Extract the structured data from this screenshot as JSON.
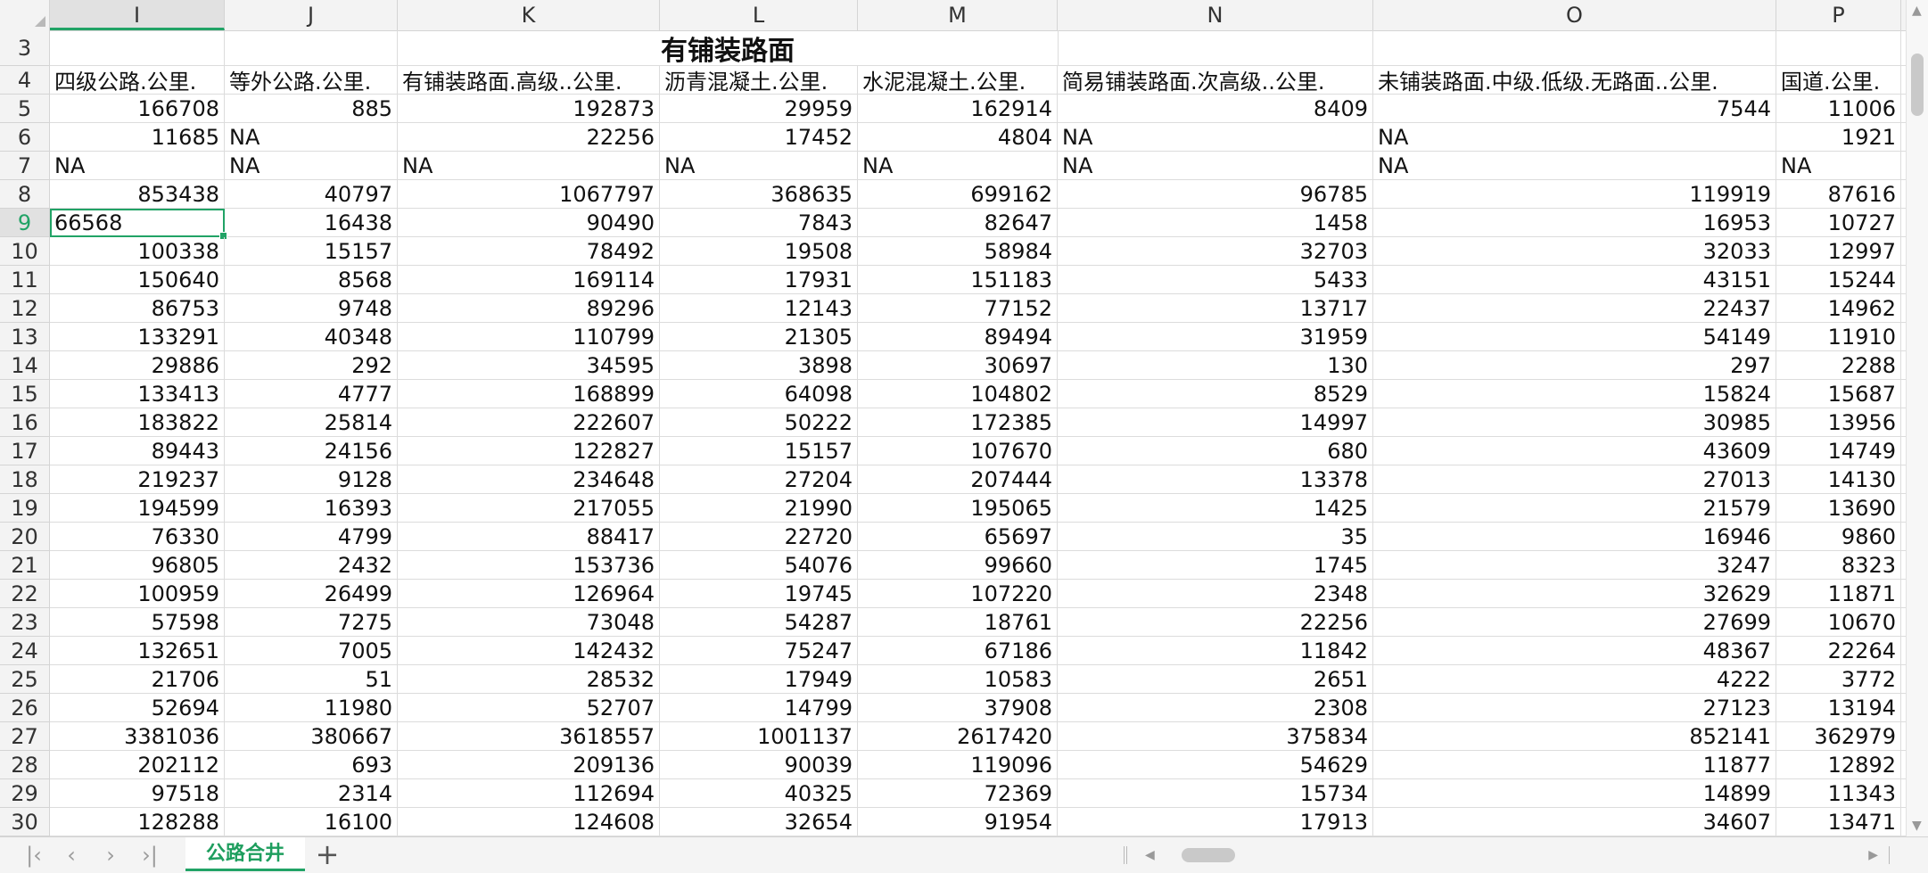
{
  "columns": [
    "I",
    "J",
    "K",
    "L",
    "M",
    "N",
    "O",
    "P"
  ],
  "active_column": "I",
  "active_row": "9",
  "title": "有铺装路面",
  "headers": [
    "四级公路.公里.",
    "等外公路.公里.",
    "有铺装路面.高级..公里.",
    "沥青混凝土.公里.",
    "水泥混凝土.公里.",
    "简易铺装路面.次高级..公里.",
    "未铺装路面.中级.低级.无路面..公里.",
    "国道.公里."
  ],
  "rows": [
    {
      "n": "5",
      "v": [
        "166708",
        "885",
        "192873",
        "29959",
        "162914",
        "8409",
        "7544",
        "11006"
      ]
    },
    {
      "n": "6",
      "v": [
        "11685",
        "NA",
        "22256",
        "17452",
        "4804",
        "NA",
        "NA",
        "1921"
      ]
    },
    {
      "n": "7",
      "v": [
        "NA",
        "NA",
        "NA",
        "NA",
        "NA",
        "NA",
        "NA",
        "NA"
      ]
    },
    {
      "n": "8",
      "v": [
        "853438",
        "40797",
        "1067797",
        "368635",
        "699162",
        "96785",
        "119919",
        "87616"
      ]
    },
    {
      "n": "9",
      "v": [
        "66568",
        "16438",
        "90490",
        "7843",
        "82647",
        "1458",
        "16953",
        "10727"
      ]
    },
    {
      "n": "10",
      "v": [
        "100338",
        "15157",
        "78492",
        "19508",
        "58984",
        "32703",
        "32033",
        "12997"
      ]
    },
    {
      "n": "11",
      "v": [
        "150640",
        "8568",
        "169114",
        "17931",
        "151183",
        "5433",
        "43151",
        "15244"
      ]
    },
    {
      "n": "12",
      "v": [
        "86753",
        "9748",
        "89296",
        "12143",
        "77152",
        "13717",
        "22437",
        "14962"
      ]
    },
    {
      "n": "13",
      "v": [
        "133291",
        "40348",
        "110799",
        "21305",
        "89494",
        "31959",
        "54149",
        "11910"
      ]
    },
    {
      "n": "14",
      "v": [
        "29886",
        "292",
        "34595",
        "3898",
        "30697",
        "130",
        "297",
        "2288"
      ]
    },
    {
      "n": "15",
      "v": [
        "133413",
        "4777",
        "168899",
        "64098",
        "104802",
        "8529",
        "15824",
        "15687"
      ]
    },
    {
      "n": "16",
      "v": [
        "183822",
        "25814",
        "222607",
        "50222",
        "172385",
        "14997",
        "30985",
        "13956"
      ]
    },
    {
      "n": "17",
      "v": [
        "89443",
        "24156",
        "122827",
        "15157",
        "107670",
        "680",
        "43609",
        "14749"
      ]
    },
    {
      "n": "18",
      "v": [
        "219237",
        "9128",
        "234648",
        "27204",
        "207444",
        "13378",
        "27013",
        "14130"
      ]
    },
    {
      "n": "19",
      "v": [
        "194599",
        "16393",
        "217055",
        "21990",
        "195065",
        "1425",
        "21579",
        "13690"
      ]
    },
    {
      "n": "20",
      "v": [
        "76330",
        "4799",
        "88417",
        "22720",
        "65697",
        "35",
        "16946",
        "9860"
      ]
    },
    {
      "n": "21",
      "v": [
        "96805",
        "2432",
        "153736",
        "54076",
        "99660",
        "1745",
        "3247",
        "8323"
      ]
    },
    {
      "n": "22",
      "v": [
        "100959",
        "26499",
        "126964",
        "19745",
        "107220",
        "2348",
        "32629",
        "11871"
      ]
    },
    {
      "n": "23",
      "v": [
        "57598",
        "7275",
        "73048",
        "54287",
        "18761",
        "22256",
        "27699",
        "10670"
      ]
    },
    {
      "n": "24",
      "v": [
        "132651",
        "7005",
        "142432",
        "75247",
        "67186",
        "11842",
        "48367",
        "22264"
      ]
    },
    {
      "n": "25",
      "v": [
        "21706",
        "51",
        "28532",
        "17949",
        "10583",
        "2651",
        "4222",
        "3772"
      ]
    },
    {
      "n": "26",
      "v": [
        "52694",
        "11980",
        "52707",
        "14799",
        "37908",
        "2308",
        "27123",
        "13194"
      ]
    },
    {
      "n": "27",
      "v": [
        "3381036",
        "380667",
        "3618557",
        "1001137",
        "2617420",
        "375834",
        "852141",
        "362979"
      ]
    },
    {
      "n": "28",
      "v": [
        "202112",
        "693",
        "209136",
        "90039",
        "119096",
        "54629",
        "11877",
        "12892"
      ]
    },
    {
      "n": "29",
      "v": [
        "97518",
        "2314",
        "112694",
        "40325",
        "72369",
        "15734",
        "14899",
        "11343"
      ]
    },
    {
      "n": "30",
      "v": [
        "128288",
        "16100",
        "124608",
        "32654",
        "91954",
        "17913",
        "34607",
        "13471"
      ]
    }
  ],
  "sheet_tab": "公路合井",
  "nav": {
    "first": "|‹",
    "prev": "‹",
    "next": "›",
    "last": "›|",
    "add": "+"
  },
  "colors": {
    "accent": "#21a366"
  }
}
